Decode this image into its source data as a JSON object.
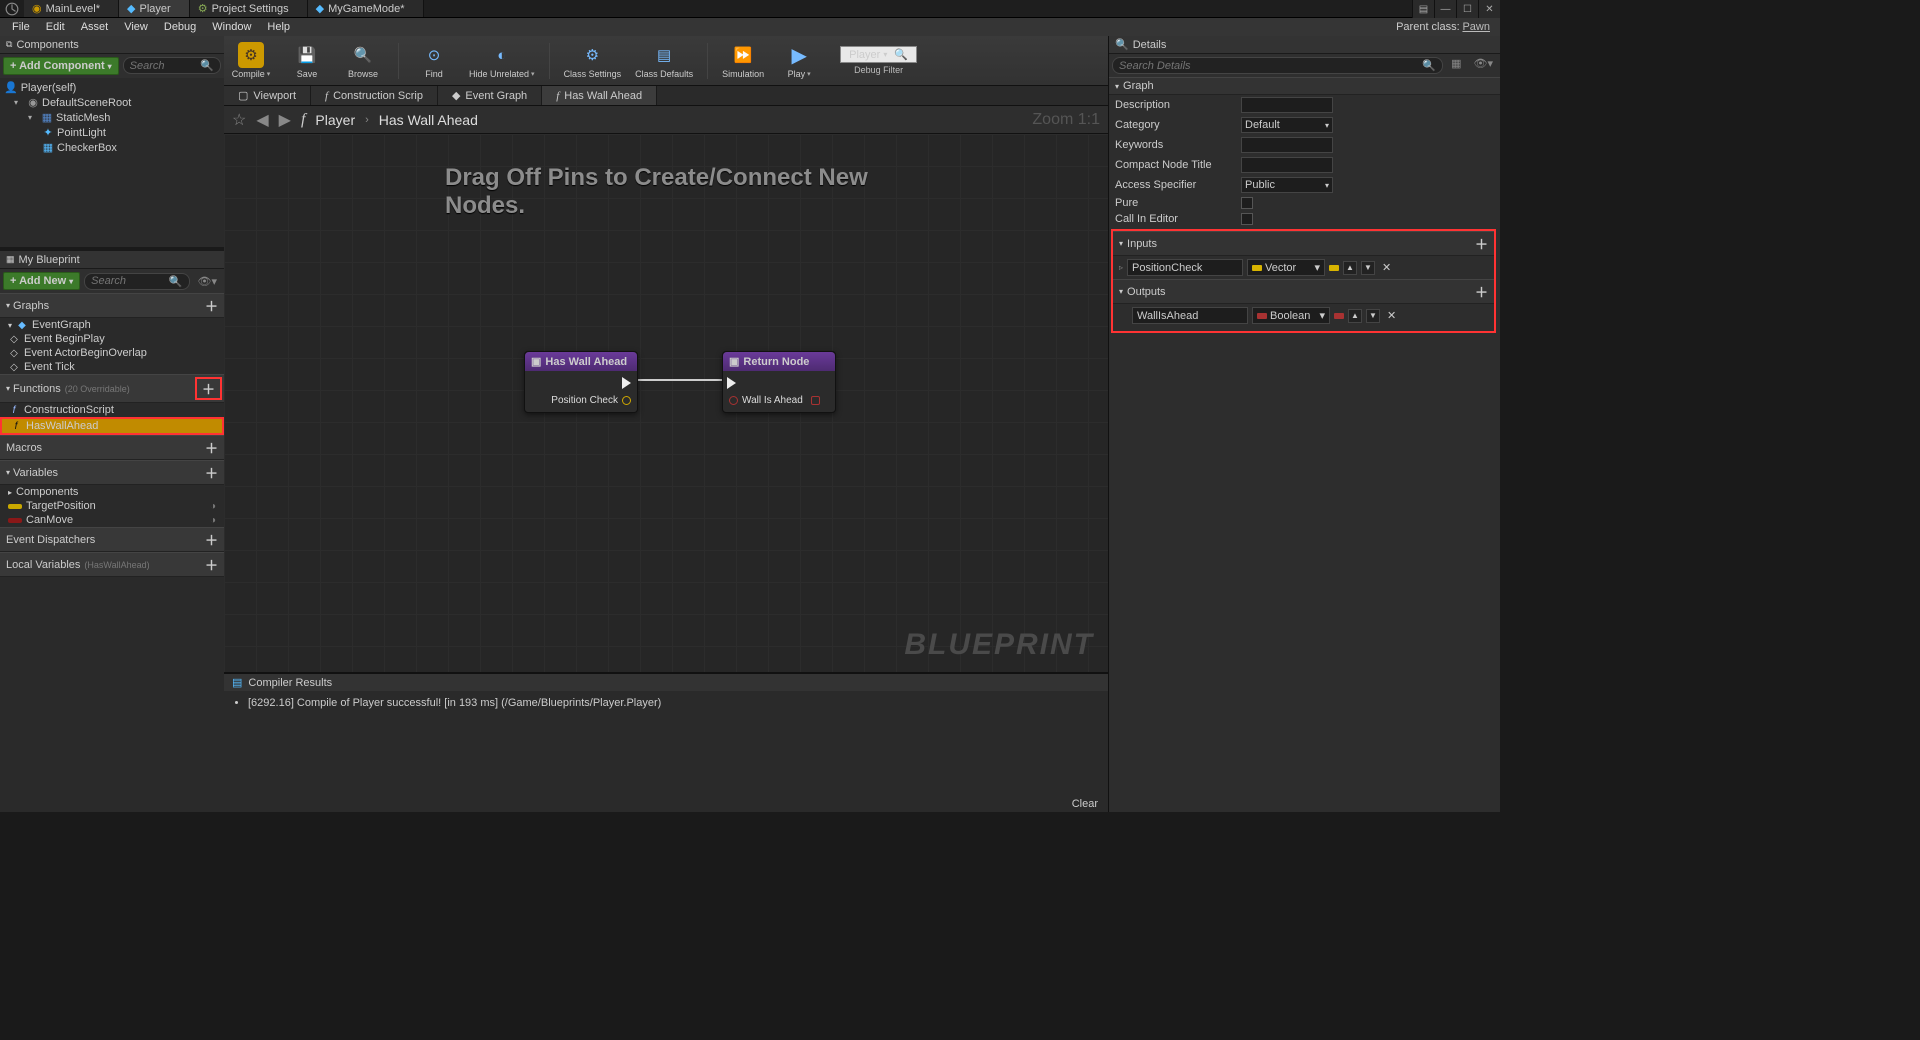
{
  "top_tabs": {
    "t0": "MainLevel*",
    "t1": "Player",
    "t2": "Project Settings",
    "t3": "MyGameMode*"
  },
  "menu": {
    "file": "File",
    "edit": "Edit",
    "asset": "Asset",
    "view": "View",
    "debug": "Debug",
    "window": "Window",
    "help": "Help"
  },
  "parent_class": {
    "label": "Parent class:",
    "value": "Pawn"
  },
  "components_panel": {
    "title": "Components",
    "add": "+ Add Component",
    "search_placeholder": "Search",
    "root": "Player(self)",
    "scene": "DefaultSceneRoot",
    "mesh": "StaticMesh",
    "light": "PointLight",
    "box": "CheckerBox"
  },
  "mybp": {
    "title": "My Blueprint",
    "add": "+ Add New",
    "search_placeholder": "Search",
    "graphs": "Graphs",
    "eventgraph": "EventGraph",
    "ev_begin": "Event BeginPlay",
    "ev_overlap": "Event ActorBeginOverlap",
    "ev_tick": "Event Tick",
    "functions": "Functions",
    "functions_sub": "(20 Overridable)",
    "constr": "ConstructionScript",
    "haswall": "HasWallAhead",
    "macros": "Macros",
    "variables": "Variables",
    "var_components": "Components",
    "var_target": "TargetPosition",
    "var_canmove": "CanMove",
    "dispatchers": "Event Dispatchers",
    "locals": "Local Variables",
    "locals_sub": "(HasWallAhead)"
  },
  "toolbar": {
    "compile": "Compile",
    "save": "Save",
    "browse": "Browse",
    "find": "Find",
    "hide": "Hide Unrelated",
    "class_settings": "Class Settings",
    "class_defaults": "Class Defaults",
    "simulation": "Simulation",
    "play": "Play",
    "player_chip": "Player",
    "debug_filter": "Debug Filter"
  },
  "graph_tabs": {
    "viewport": "Viewport",
    "constr": "Construction Scrip",
    "event": "Event Graph",
    "haswall": "Has Wall Ahead"
  },
  "graph_header": {
    "crumb1": "Player",
    "crumb2": "Has Wall Ahead",
    "zoom": "Zoom 1:1"
  },
  "graph_hint": "Drag Off Pins to Create/Connect New Nodes.",
  "watermark": "BLUEPRINT",
  "nodes": {
    "n1_title": "Has Wall Ahead",
    "n1_pin": "Position Check",
    "n2_title": "Return Node",
    "n2_pin": "Wall Is Ahead"
  },
  "compiler": {
    "title": "Compiler Results",
    "line": "[6292.16] Compile of Player successful! [in 193 ms] (/Game/Blueprints/Player.Player)",
    "clear": "Clear"
  },
  "details": {
    "title": "Details",
    "search_placeholder": "Search Details",
    "graph": "Graph",
    "description": "Description",
    "category": "Category",
    "category_value": "Default",
    "keywords": "Keywords",
    "compact": "Compact Node Title",
    "access": "Access Specifier",
    "access_value": "Public",
    "pure": "Pure",
    "call_editor": "Call In Editor",
    "inputs": "Inputs",
    "outputs": "Outputs",
    "in_name": "PositionCheck",
    "in_type": "Vector",
    "out_name": "WallIsAhead",
    "out_type": "Boolean"
  }
}
